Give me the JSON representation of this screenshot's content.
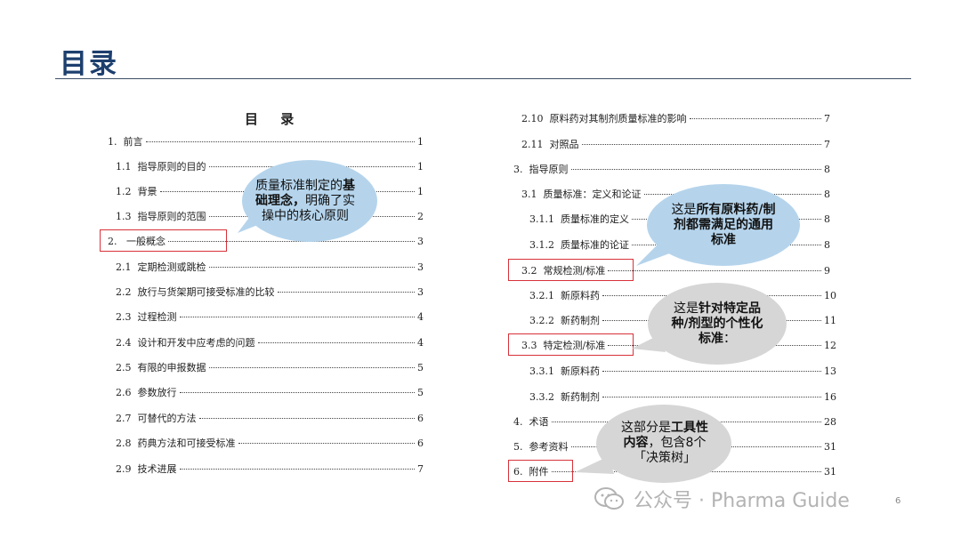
{
  "header": {
    "title": "目录"
  },
  "document": {
    "toc_title": "目 录",
    "left_entries": [
      {
        "num": "1.",
        "label": "前言",
        "page": "1"
      },
      {
        "num": "1.1",
        "label": "指导原则的目的",
        "page": "1"
      },
      {
        "num": "1.2",
        "label": "背景",
        "page": "1"
      },
      {
        "num": "1.3",
        "label": "指导原则的范围",
        "page": "2"
      },
      {
        "num": "2.",
        "label": "一般概念",
        "page": "3"
      },
      {
        "num": "2.1",
        "label": "定期检测或跳检",
        "page": "3"
      },
      {
        "num": "2.2",
        "label": "放行与货架期可接受标准的比较",
        "page": "3"
      },
      {
        "num": "2.3",
        "label": "过程检测",
        "page": "4"
      },
      {
        "num": "2.4",
        "label": "设计和开发中应考虑的问题",
        "page": "4"
      },
      {
        "num": "2.5",
        "label": "有限的申报数据",
        "page": "5"
      },
      {
        "num": "2.6",
        "label": "参数放行",
        "page": "5"
      },
      {
        "num": "2.7",
        "label": "可替代的方法",
        "page": "6"
      },
      {
        "num": "2.8",
        "label": "药典方法和可接受标准",
        "page": "6"
      },
      {
        "num": "2.9",
        "label": "技术进展",
        "page": "7"
      }
    ],
    "right_entries": [
      {
        "num": "2.10",
        "label": "原料药对其制剂质量标准的影响",
        "page": "7"
      },
      {
        "num": "2.11",
        "label": "对照品",
        "page": "7"
      },
      {
        "num": "3.",
        "label": "指导原则",
        "page": "8"
      },
      {
        "num": "3.1",
        "label": "质量标准：定义和论证",
        "page": "8"
      },
      {
        "num": "3.1.1",
        "label": "质量标准的定义",
        "page": "8"
      },
      {
        "num": "3.1.2",
        "label": "质量标准的论证",
        "page": "8"
      },
      {
        "num": "3.2",
        "label": "常规检测/标准",
        "page": "9"
      },
      {
        "num": "3.2.1",
        "label": "新原料药",
        "page": "10"
      },
      {
        "num": "3.2.2",
        "label": "新药制剂",
        "page": "11"
      },
      {
        "num": "3.3",
        "label": "特定检测/标准",
        "page": "12"
      },
      {
        "num": "3.3.1",
        "label": "新原料药",
        "page": "13"
      },
      {
        "num": "3.3.2",
        "label": "新药制剂",
        "page": "16"
      },
      {
        "num": "4.",
        "label": "术语",
        "page": "28"
      },
      {
        "num": "5.",
        "label": "参考资料",
        "page": "31"
      },
      {
        "num": "6.",
        "label": "附件",
        "page": "31"
      }
    ]
  },
  "callouts": {
    "c1": {
      "pre": "质量标准制定的",
      "bold": "基础理念，",
      "post": "明确了实操中的核心原则"
    },
    "c2": {
      "pre": "这是",
      "bold": "所有原料药/制剂都需满足的通用标准",
      "post": ""
    },
    "c3": {
      "pre": "这是",
      "bold": "针对特定品种/剂型的个性化标准",
      "post": "："
    },
    "c4": {
      "pre": "这部分是",
      "bold": "工具性内容",
      "post": "，包含8个「决策树」"
    }
  },
  "watermark": {
    "text": "公众号 · Pharma Guide"
  },
  "page_number": "6",
  "colors": {
    "title": "#1d3f6e",
    "highlight_box": "#d8323a",
    "bubble_blue": "#b5d4ec",
    "bubble_gray": "#d6d6d6"
  }
}
